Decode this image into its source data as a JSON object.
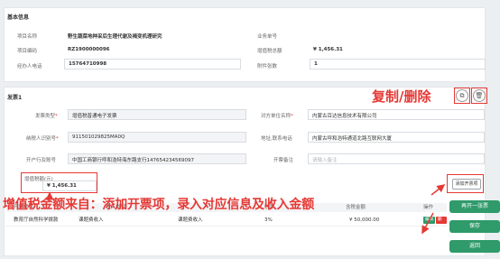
{
  "basic": {
    "title": "基本信息",
    "project_name_label": "项目名称",
    "project_name": "野生蔬菜地种采后生理代谢及褐变机理研究",
    "business_no_label": "业务单号",
    "project_code_label": "项目编码",
    "project_code": "RZ1900000096",
    "total_vat_label": "增值税总额",
    "total_vat": "¥ 1,456.31",
    "phone_label": "经办人电话",
    "phone": "15764710998",
    "attachments_label": "附件张数",
    "attachments": "1"
  },
  "invoice": {
    "title": "发票1",
    "type_label": "发票类型",
    "type_value": "增值税普通电子发票",
    "counterparty_label": "对方单位名称",
    "counterparty_value": "内蒙古百达信息技术有限公司",
    "taxid_label": "纳税人识别号",
    "taxid_value": "911501029825MA0Q",
    "addr_label": "地址,联系电话",
    "addr_value": "内蒙古呼和浩特通道北路互联网大厦",
    "bank_label": "开户行及账号",
    "bank_value": "中国工商银行呼和浩特海东路支行147654234569097",
    "remark_label": "开票备注",
    "remark_placeholder": "请输入备注",
    "vat_label": "增值税额(元)",
    "vat_value": "¥ 1,456.31",
    "add_item_button": "添加开票项"
  },
  "table": {
    "headers": [
      "开票项目",
      "收入类型",
      "税率",
      "含税金额",
      "操作"
    ],
    "row": {
      "project": "教育厅自然科学拨款",
      "income_type": "课题费收入",
      "income_type2": "课题费收入",
      "tax_rate": "3%",
      "amount": "¥ 50,000.00",
      "edit": "编辑",
      "delete": "删除"
    }
  },
  "annotations": {
    "copy_delete": "复制/删除",
    "explain": "增值税金额来自：添加开票项，录入对应信息及收入金额"
  },
  "buttons": {
    "add_invoice": "再开一张票",
    "save": "保存",
    "back": "返回"
  },
  "colors": {
    "accent_red": "#e53935",
    "primary_green": "#2f9a6a"
  }
}
